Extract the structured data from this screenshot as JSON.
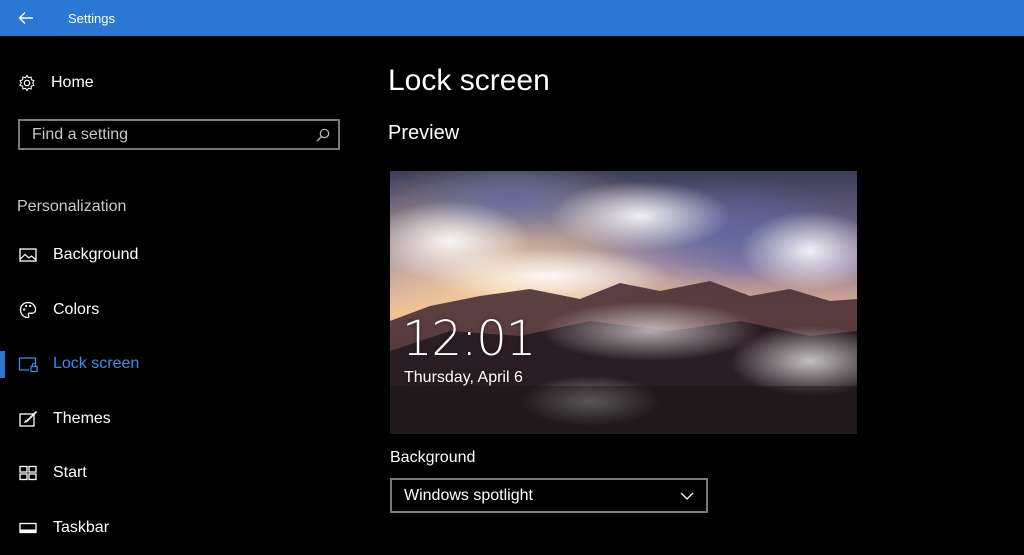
{
  "window": {
    "title": "Settings"
  },
  "sidebar": {
    "home_label": "Home",
    "search": {
      "placeholder": "Find a setting"
    },
    "section_label": "Personalization",
    "items": [
      {
        "label": "Background",
        "icon": "image-icon",
        "active": false
      },
      {
        "label": "Colors",
        "icon": "palette-icon",
        "active": false
      },
      {
        "label": "Lock screen",
        "icon": "lock-screen-icon",
        "active": true
      },
      {
        "label": "Themes",
        "icon": "themes-icon",
        "active": false
      },
      {
        "label": "Start",
        "icon": "start-icon",
        "active": false
      },
      {
        "label": "Taskbar",
        "icon": "taskbar-icon",
        "active": false
      }
    ]
  },
  "main": {
    "title": "Lock screen",
    "preview_heading": "Preview",
    "preview": {
      "time": "12:01",
      "date": "Thursday, April 6"
    },
    "background_label": "Background",
    "background_value": "Windows spotlight"
  },
  "colors": {
    "accent": "#2b78d4",
    "active_text": "#3c8ce6",
    "background": "#000000"
  }
}
